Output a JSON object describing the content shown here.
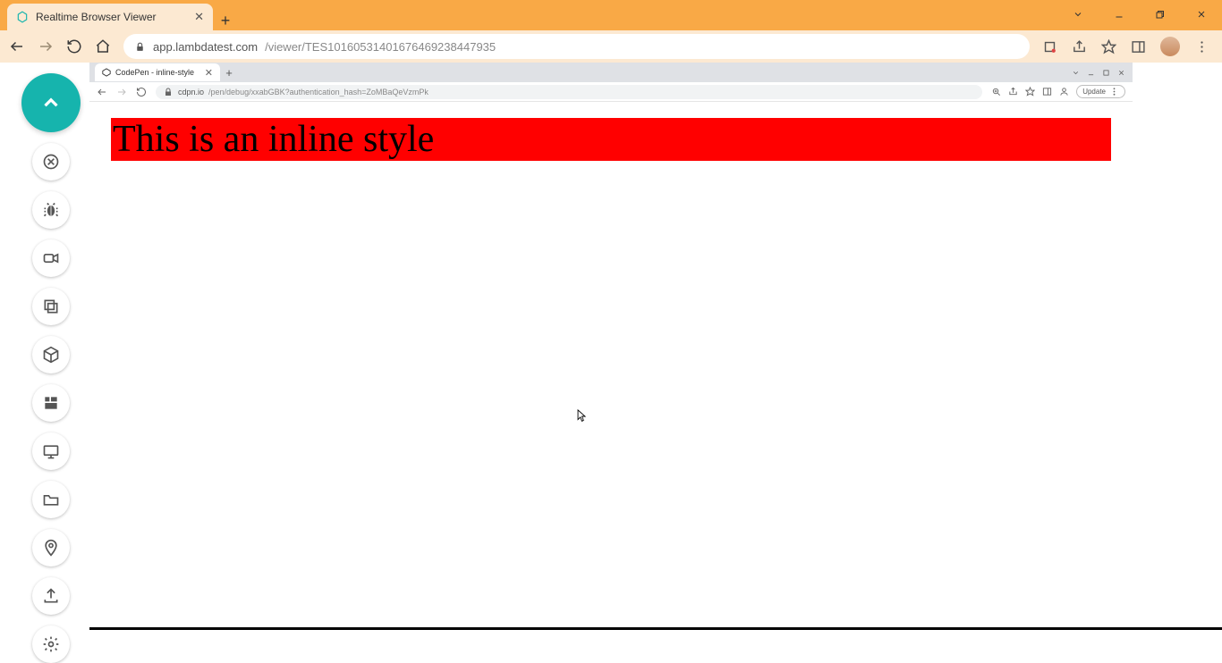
{
  "outer": {
    "tab_title": "Realtime Browser Viewer",
    "url_host": "app.lambdatest.com",
    "url_path": "/viewer/TES10160531401676469238447935"
  },
  "sidebar_buttons": [
    "switch",
    "bug",
    "video",
    "copy",
    "box",
    "layout",
    "display",
    "folder",
    "location",
    "upload",
    "settings"
  ],
  "inner": {
    "tab_title": "CodePen - inline-style",
    "url_host": "cdpn.io",
    "url_path": "/pen/debug/xxabGBK?authentication_hash=ZoMBaQeVzmPk",
    "update_label": "Update"
  },
  "page": {
    "headline": "This is an inline style"
  }
}
